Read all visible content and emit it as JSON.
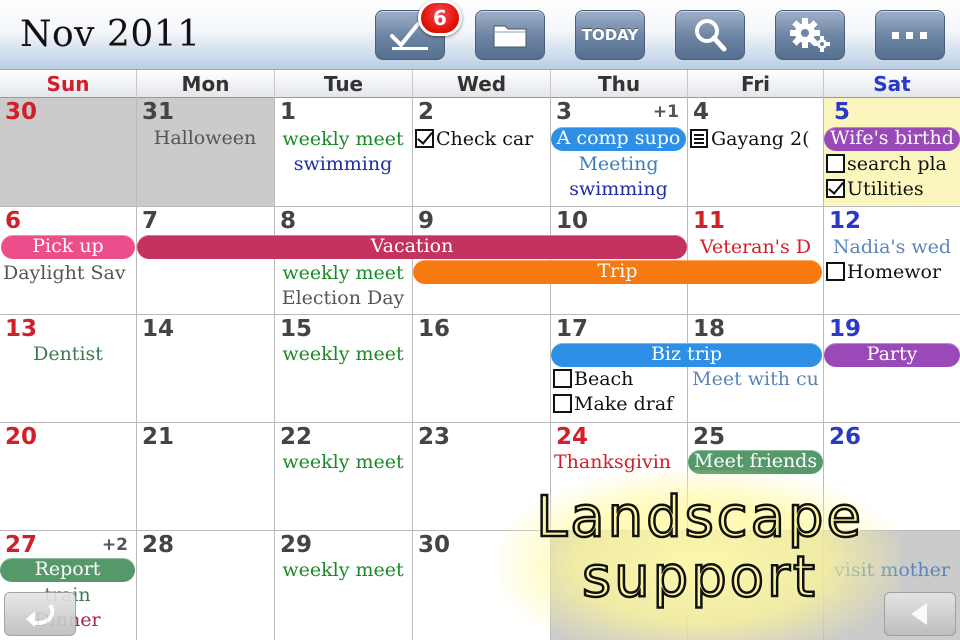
{
  "header": {
    "title": "Nov 2011",
    "todo_badge": "6",
    "today_label": "TODAY"
  },
  "weekdays": [
    "Sun",
    "Mon",
    "Tue",
    "Wed",
    "Thu",
    "Fri",
    "Sat"
  ],
  "days": {
    "d30": "30",
    "d31": "31",
    "d1": "1",
    "d2": "2",
    "d3": "3",
    "d4": "4",
    "d5": "5",
    "d6": "6",
    "d7": "7",
    "d8": "8",
    "d9": "9",
    "d10": "10",
    "d11": "11",
    "d12": "12",
    "d13": "13",
    "d14": "14",
    "d15": "15",
    "d16": "16",
    "d17": "17",
    "d18": "18",
    "d19": "19",
    "d20": "20",
    "d21": "21",
    "d22": "22",
    "d23": "23",
    "d24": "24",
    "d25": "25",
    "d26": "26",
    "d27": "27",
    "d28": "28",
    "d29": "29",
    "d30b": "30"
  },
  "more": {
    "nov3": "+1",
    "nov27": "+2"
  },
  "events": {
    "halloween": "Halloween",
    "weekly_meet": "weekly meet",
    "swimming": "swimming",
    "check_car": "Check car",
    "comp_supo": "A comp supo",
    "meeting": "Meeting",
    "gayang": "Gayang 2(",
    "wifes_birthday": "Wife's birthd",
    "search_pla": "search pla",
    "utilities": "Utilities",
    "pick_up": "Pick up",
    "vacation": "Vacation",
    "veterans_day": "Veteran's D",
    "nadias_wed": "Nadia's wed",
    "daylight_sav": "Daylight Sav",
    "trip": "Trip",
    "election_day": "Election Day",
    "homework": "Homewor",
    "dentist": "Dentist",
    "biz_trip": "Biz trip",
    "party": "Party",
    "beach": "Beach",
    "meet_with_cu": "Meet with cu",
    "make_draf": "Make draf",
    "thanksgiving": "Thanksgivin",
    "meet_friends": "Meet friends",
    "report": "Report",
    "train": "train",
    "dinner": "Dinner",
    "visit_mother": "visit mother"
  },
  "promo": {
    "line1": "Landscape",
    "line2": "support"
  },
  "colors": {
    "pink": "#ee4d8b",
    "crimson": "#c43260",
    "orange": "#f77a10",
    "blue": "#2d8fe6",
    "purple": "#9a49b8",
    "green": "#55996a",
    "text_green": "#1b8a26",
    "text_navy": "#1f2fa0",
    "text_red": "#d0202a",
    "text_steel": "#5d86b8"
  },
  "icons": [
    "checklist-icon",
    "folder-icon",
    "search-icon",
    "gear-icon",
    "more-icon",
    "back-arrow-icon",
    "left-arrow-icon"
  ]
}
